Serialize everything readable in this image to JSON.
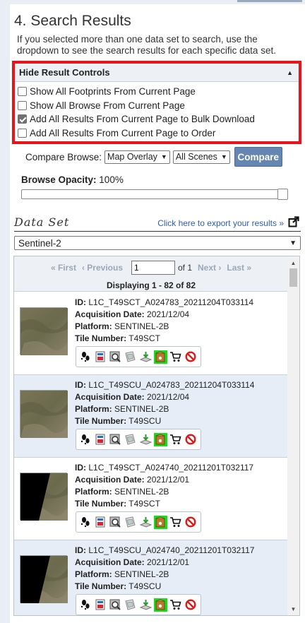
{
  "page": {
    "title": "4. Search Results",
    "intro": "If you selected more than one data set to search, use the dropdown to see the search results for each specific data set."
  },
  "controls": {
    "header": "Hide Result Controls",
    "checkboxes": [
      {
        "label": "Show All Footprints From Current Page",
        "checked": false
      },
      {
        "label": "Show All Browse From Current Page",
        "checked": false
      },
      {
        "label": "Add All Results From Current Page to Bulk Download",
        "checked": true
      },
      {
        "label": "Add All Results From Current Page to Order",
        "checked": false
      }
    ],
    "highlight_color": "#e8141c"
  },
  "compare": {
    "label": "Compare Browse:",
    "mode_selected": "Map Overlay",
    "scenes_selected": "All Scenes",
    "button": "Compare"
  },
  "opacity": {
    "label": "Browse Opacity:",
    "value": "100%",
    "level_percent": 100
  },
  "dataset": {
    "title": "Data Set",
    "export_link": "Click here to export your results »",
    "selected": "Sentinel-2"
  },
  "pager": {
    "first": "« First",
    "previous": "‹ Previous",
    "page_value": "1",
    "of": "of 1",
    "next": "Next ›",
    "last": "Last »",
    "displaying": "Displaying 1 - 82 of 82"
  },
  "labels": {
    "id": "ID:",
    "acq": "Acquisition Date:",
    "platform": "Platform:",
    "tile": "Tile Number:"
  },
  "results": [
    {
      "id": "L1C_T49SCT_A024783_20211204T033114",
      "date": "2021/12/04",
      "platform": "SENTINEL-2B",
      "tile": "T49SCT",
      "thumb": "full"
    },
    {
      "id": "L1C_T49SCU_A024783_20211204T033114",
      "date": "2021/12/04",
      "platform": "SENTINEL-2B",
      "tile": "T49SCU",
      "thumb": "full"
    },
    {
      "id": "L1C_T49SCT_A024740_20211201T032117",
      "date": "2021/12/01",
      "platform": "SENTINEL-2B",
      "tile": "T49SCT",
      "thumb": "partial-left"
    },
    {
      "id": "L1C_T49SCU_A024740_20211201T032117",
      "date": "2021/12/01",
      "platform": "SENTINEL-2B",
      "tile": "T49SCU",
      "thumb": "partial-left"
    }
  ],
  "icons": [
    "footprint-icon",
    "metadata-icon",
    "browse-overlay-icon",
    "compare-browse-icon",
    "download-icon",
    "bulk-download-icon",
    "order-cart-icon",
    "exclude-icon"
  ],
  "colors": {
    "accent": "#6585b2",
    "bulk_highlight": "#14e01a",
    "link": "#2a5fb0"
  }
}
